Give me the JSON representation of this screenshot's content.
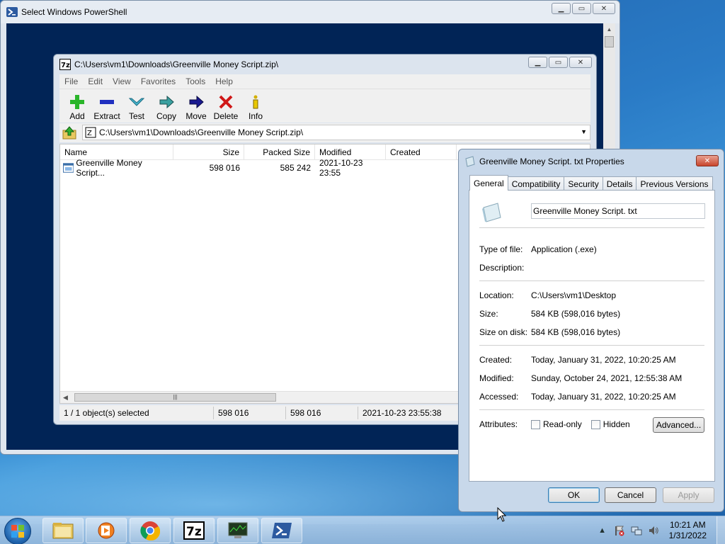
{
  "powershell": {
    "title": "Select Windows PowerShell"
  },
  "zip": {
    "title": "C:\\Users\\vm1\\Downloads\\Greenville Money Script.zip\\",
    "menu": [
      "File",
      "Edit",
      "View",
      "Favorites",
      "Tools",
      "Help"
    ],
    "toolbar": [
      {
        "label": "Add",
        "icon": "plus-icon"
      },
      {
        "label": "Extract",
        "icon": "minus-icon"
      },
      {
        "label": "Test",
        "icon": "check-icon"
      },
      {
        "label": "Copy",
        "icon": "copy-arrow-icon"
      },
      {
        "label": "Move",
        "icon": "move-arrow-icon"
      },
      {
        "label": "Delete",
        "icon": "delete-x-icon"
      },
      {
        "label": "Info",
        "icon": "info-icon"
      }
    ],
    "address": "C:\\Users\\vm1\\Downloads\\Greenville Money Script.zip\\",
    "columns": [
      "Name",
      "Size",
      "Packed Size",
      "Modified",
      "Created"
    ],
    "rows": [
      {
        "name": "Greenville Money Script...",
        "size": "598 016",
        "packed": "585 242",
        "modified": "2021-10-23 23:55",
        "created": ""
      }
    ],
    "hscroll_thumb": "|||",
    "status": {
      "selected": "1 / 1 object(s) selected",
      "size": "598 016",
      "packed": "598 016",
      "date": "2021-10-23 23:55:38"
    }
  },
  "props": {
    "title": "Greenville Money Script. txt Properties",
    "tabs": [
      "General",
      "Compatibility",
      "Security",
      "Details",
      "Previous Versions"
    ],
    "filename": "Greenville Money Script. txt",
    "type_label": "Type of file:",
    "type_value": "Application (.exe)",
    "desc_label": "Description:",
    "desc_value": "",
    "location_label": "Location:",
    "location_value": "C:\\Users\\vm1\\Desktop",
    "size_label": "Size:",
    "size_value": "584 KB (598,016 bytes)",
    "disk_label": "Size on disk:",
    "disk_value": "584 KB (598,016 bytes)",
    "created_label": "Created:",
    "created_value": "Today, January 31, 2022, 10:20:25 AM",
    "modified_label": "Modified:",
    "modified_value": "Sunday, October 24, 2021, 12:55:38 AM",
    "accessed_label": "Accessed:",
    "accessed_value": "Today, January 31, 2022, 10:20:25 AM",
    "attributes_label": "Attributes:",
    "readonly_label": "Read-only",
    "hidden_label": "Hidden",
    "advanced_label": "Advanced...",
    "ok_label": "OK",
    "cancel_label": "Cancel",
    "apply_label": "Apply"
  },
  "taskbar": {
    "time": "10:21 AM",
    "date": "1/31/2022",
    "items": [
      "file-explorer-icon",
      "media-player-icon",
      "chrome-icon",
      "7zip-icon",
      "task-manager-icon",
      "powershell-icon"
    ]
  },
  "colors": {
    "ps_bg": "#012456",
    "accent": "#3c7fb1"
  }
}
